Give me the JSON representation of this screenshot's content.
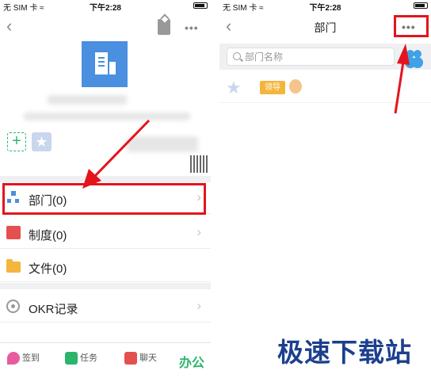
{
  "left": {
    "statusbar": {
      "carrier": "无 SIM 卡 ≈",
      "time": "下午2:28"
    },
    "navbar": {
      "back": "‹",
      "more": "•••"
    },
    "menu": [
      {
        "label": "部门(0)",
        "icon": "org-chart-icon",
        "highlighted": true
      },
      {
        "label": "制度(0)",
        "icon": "rules-icon",
        "highlighted": false
      },
      {
        "label": "文件(0)",
        "icon": "folder-icon",
        "highlighted": false
      },
      {
        "label": "OKR记录",
        "icon": "target-icon",
        "highlighted": false
      }
    ],
    "chevron": "›",
    "tabbar": {
      "checkin": "签到",
      "task": "任务",
      "chat": "聊天",
      "office": "办公"
    },
    "colors": {
      "brand_green": "#2ab56b",
      "highlight_red": "#e3141d",
      "logo_blue": "#4a8fe0"
    }
  },
  "right": {
    "statusbar": {
      "carrier": "无 SIM 卡 ≈",
      "time": "下午2:28"
    },
    "navbar": {
      "back": "‹",
      "title": "部门",
      "more": "•••"
    },
    "search": {
      "placeholder": "部门名称"
    },
    "dept_tag": "领导"
  },
  "watermark": "极速下载站"
}
